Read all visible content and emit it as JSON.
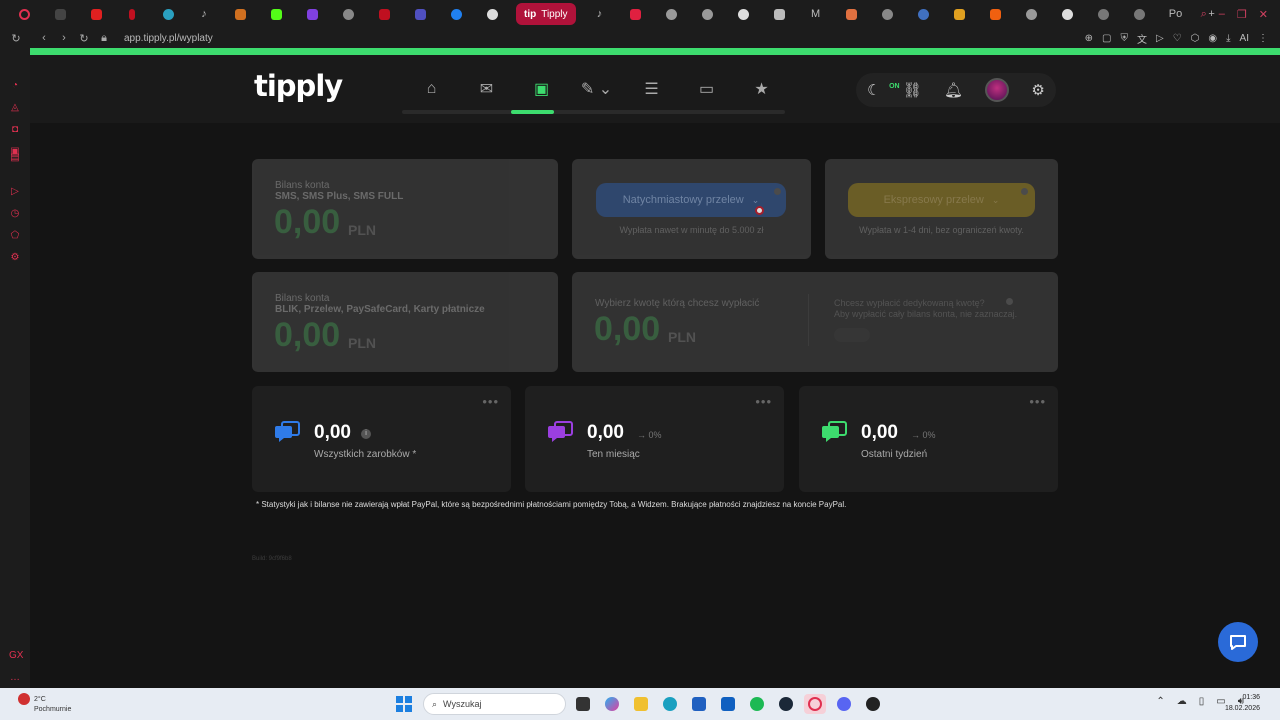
{
  "browser": {
    "active_tab_label": "Tipply",
    "tab_right_label": "Po",
    "url": "app.tipply.pl/wyplaty"
  },
  "header": {
    "logo": "tipply",
    "on_badge": "ON"
  },
  "balance_sms": {
    "label": "Bilans konta",
    "sub": "SMS, SMS Plus, SMS FULL",
    "value": "0,00",
    "currency": "PLN"
  },
  "balance_blik": {
    "label": "Bilans konta",
    "sub": "BLIK, Przelew, PaySafeCard, Karty płatnicze",
    "value": "0,00",
    "currency": "PLN"
  },
  "instant_payout": {
    "button": "Natychmiastowy przelew",
    "note": "Wypłata nawet w minutę do 5.000 zł"
  },
  "express_payout": {
    "button": "Ekspresowy przelew",
    "note": "Wypłata w 1-4 dni, bez ograniczeń kwoty."
  },
  "choose_amount": {
    "label": "Wybierz kwotę którą chcesz wypłacić",
    "value": "0,00",
    "currency": "PLN",
    "dedicated_line1": "Chcesz wypłacić dedykowaną kwotę?",
    "dedicated_line2": "Aby wypłacić cały bilans konta, nie zaznaczaj."
  },
  "stats": [
    {
      "value": "0,00",
      "delta": "",
      "label": "Wszystkich zarobków *",
      "color": "#2f7be8"
    },
    {
      "value": "0,00",
      "delta": "→ 0%",
      "label": "Ten miesiąc",
      "color": "#9b3fe0"
    },
    {
      "value": "0,00",
      "delta": "→ 0%",
      "label": "Ostatni tydzień",
      "color": "#3ddc6e"
    }
  ],
  "stat_dots": "•••",
  "footnote": "* Statystyki jak i bilanse nie zawierają wpłat PayPal, które są bezpośrednimi płatnościami pomiędzy Tobą, a Widzem. Brakujące płatności znajdziesz na koncie PayPal.",
  "build": "Build: 9cf9f6b8",
  "taskbar": {
    "temp": "2°C",
    "weather": "Pochmurnie",
    "search_placeholder": "Wyszukaj",
    "time": "01:36",
    "date": "18.02.2026"
  },
  "colors": {
    "accent": "#3ddc6e",
    "chat": "#2a6ad8"
  }
}
